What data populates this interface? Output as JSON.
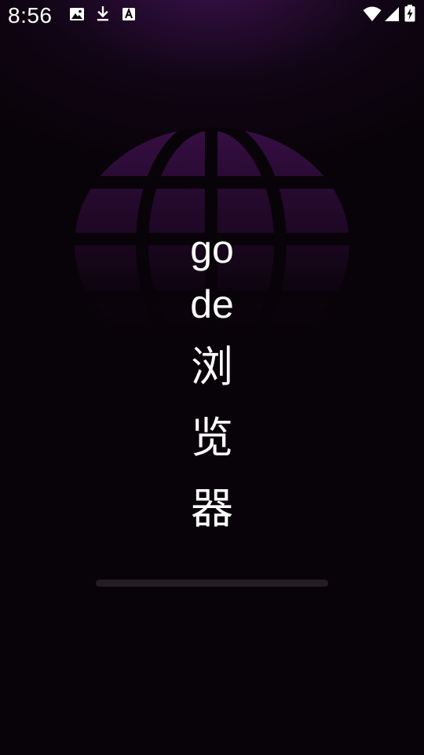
{
  "status_bar": {
    "time": "8:56",
    "left_icons": [
      "image-icon",
      "download-icon",
      "text-a-icon"
    ],
    "right_icons": [
      "wifi-icon",
      "cellular-signal-icon",
      "battery-charging-icon"
    ]
  },
  "splash": {
    "title_lines": [
      "go",
      "de",
      "浏",
      "览",
      "器"
    ],
    "background_icon": "globe-icon",
    "progress": 0
  },
  "colors": {
    "background": "#080308",
    "glow": "#461a5a",
    "globe_tint": "#3a0f48",
    "text": "#ffffff",
    "progress_track": "#231d23"
  }
}
